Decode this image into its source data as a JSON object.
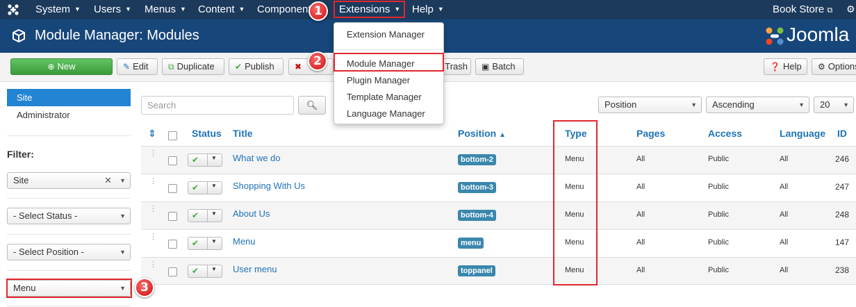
{
  "navbar": {
    "menus": [
      {
        "label": "System"
      },
      {
        "label": "Users"
      },
      {
        "label": "Menus"
      },
      {
        "label": "Content"
      },
      {
        "label": "Components"
      },
      {
        "label": "Extensions"
      },
      {
        "label": "Help"
      }
    ],
    "site_link": "Book Store",
    "icons": {
      "logo": "joomla-icon",
      "external": "external-link-icon",
      "settings": "gear-icon"
    }
  },
  "header": {
    "title": "Module Manager: Modules",
    "brand": "Joomla",
    "icon": "cube-icon"
  },
  "toolbar": {
    "new": "New",
    "edit": "Edit",
    "duplicate": "Duplicate",
    "publish": "Publish",
    "trash": "Trash",
    "batch": "Batch",
    "help": "Help",
    "options": "Options"
  },
  "sidebar": {
    "items": [
      {
        "label": "Site",
        "active": true
      },
      {
        "label": "Administrator",
        "active": false
      }
    ],
    "filter_label": "Filter:",
    "filters": {
      "client": "Site",
      "status": "- Select Status -",
      "position": "- Select Position -",
      "type": "Menu"
    }
  },
  "search": {
    "placeholder": "Search"
  },
  "sorting": {
    "order_by": "Position",
    "direction": "Ascending",
    "limit": "20"
  },
  "table": {
    "columns": {
      "status": "Status",
      "title": "Title",
      "position": "Position",
      "type": "Type",
      "pages": "Pages",
      "access": "Access",
      "language": "Language",
      "id": "ID"
    },
    "rows": [
      {
        "title": "What we do",
        "position": "bottom-2",
        "type": "Menu",
        "pages": "All",
        "access": "Public",
        "language": "All",
        "id": "246"
      },
      {
        "title": "Shopping With Us",
        "position": "bottom-3",
        "type": "Menu",
        "pages": "All",
        "access": "Public",
        "language": "All",
        "id": "247"
      },
      {
        "title": "About Us",
        "position": "bottom-4",
        "type": "Menu",
        "pages": "All",
        "access": "Public",
        "language": "All",
        "id": "248"
      },
      {
        "title": "Menu",
        "position": "menu",
        "type": "Menu",
        "pages": "All",
        "access": "Public",
        "language": "All",
        "id": "147"
      },
      {
        "title": "User menu",
        "position": "toppanel",
        "type": "Menu",
        "pages": "All",
        "access": "Public",
        "language": "All",
        "id": "238"
      }
    ]
  },
  "extensions_dropdown": {
    "items": [
      {
        "label": "Extension Manager"
      },
      {
        "label": "Module Manager"
      },
      {
        "label": "Plugin Manager"
      },
      {
        "label": "Template Manager"
      },
      {
        "label": "Language Manager"
      }
    ]
  },
  "callouts": {
    "one": "1",
    "two": "2",
    "three": "3"
  },
  "colors": {
    "navbar": "#1b3a5c",
    "header": "#17467a",
    "active": "#2384d3",
    "link": "#1f73b7",
    "badge": "#3a87ad",
    "highlight": "#e3262f",
    "new_button": "#46a546"
  }
}
